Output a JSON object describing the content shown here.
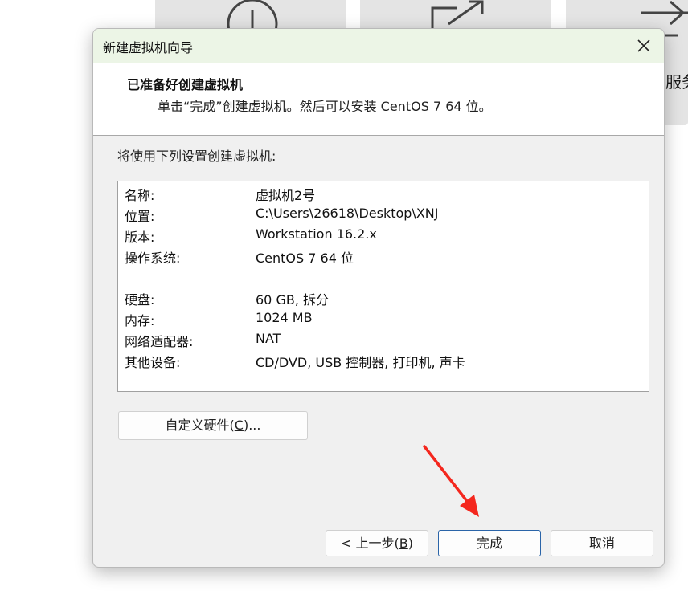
{
  "background": {
    "partial_label": "程服务"
  },
  "dialog": {
    "title": "新建虚拟机向导",
    "header_title": "已准备好创建虚拟机",
    "header_subtitle": "单击“完成”创建虚拟机。然后可以安装 CentOS 7 64 位。",
    "intro": "将使用下列设置创建虚拟机:",
    "summary": [
      {
        "label": "名称:",
        "value": "虚拟机2号"
      },
      {
        "label": "位置:",
        "value": "C:\\Users\\26618\\Desktop\\XNJ"
      },
      {
        "label": "版本:",
        "value": "Workstation 16.2.x"
      },
      {
        "label": "操作系统:",
        "value": "CentOS 7 64 位"
      },
      {
        "label": "硬盘:",
        "value": "60 GB, 拆分"
      },
      {
        "label": "内存:",
        "value": "1024 MB"
      },
      {
        "label": "网络适配器:",
        "value": "NAT"
      },
      {
        "label": "其他设备:",
        "value": "CD/DVD, USB 控制器, 打印机, 声卡"
      }
    ],
    "customize_button": {
      "prefix": "自定义硬件(",
      "key": "C",
      "suffix": ")..."
    },
    "back_button": {
      "prefix": "< 上一步(",
      "key": "B",
      "suffix": ")"
    },
    "finish_button": "完成",
    "cancel_button": "取消"
  },
  "colors": {
    "titlebar_bg": "#ecf5e6",
    "dialog_bg": "#f0f0f0",
    "finish_border": "#2a64a8",
    "annotation_arrow": "#f4271e"
  }
}
